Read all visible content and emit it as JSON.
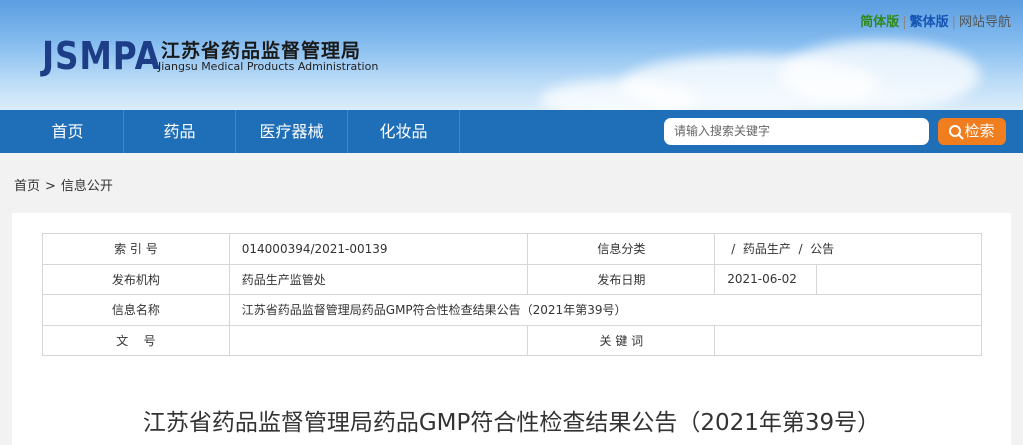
{
  "header": {
    "logo_abbr": "JSMPA",
    "logo_cn": "江苏省药品监督管理局",
    "logo_en": "Jiangsu Medical Products Administration",
    "links": {
      "simplified": "简体版",
      "sep": "|",
      "traditional": "繁体版",
      "sitemap": "网站导航"
    }
  },
  "nav": {
    "items": [
      "首页",
      "药品",
      "医疗器械",
      "化妆品"
    ],
    "search_placeholder": "请输入搜索关键字",
    "search_button": "检索"
  },
  "breadcrumb": {
    "home": "首页",
    "separator": ">",
    "current": "信息公开"
  },
  "meta_table": {
    "rows": [
      {
        "label1": "索 引 号",
        "value1": "014000394/2021-00139",
        "label2": "信息分类",
        "value2a": "/  药品生产  /  公告",
        "value2b": ""
      },
      {
        "label1": "发布机构",
        "value1": "药品生产监管处",
        "label2": "发布日期",
        "value2a": "2021-06-02",
        "value2b": ""
      },
      {
        "label1": "信息名称",
        "value1": "江苏省药品监督管理局药品GMP符合性检查结果公告（2021年第39号）"
      },
      {
        "label1": "文    号",
        "value1": "",
        "label2": "关 键 词",
        "value2a": "",
        "value2b": ""
      }
    ]
  },
  "document": {
    "title": "江苏省药品监督管理局药品GMP符合性检查结果公告（2021年第39号）"
  },
  "colors": {
    "nav_bg": "#1f6eb8",
    "search_button": "#f07e1f",
    "logo": "#1d3d86"
  }
}
